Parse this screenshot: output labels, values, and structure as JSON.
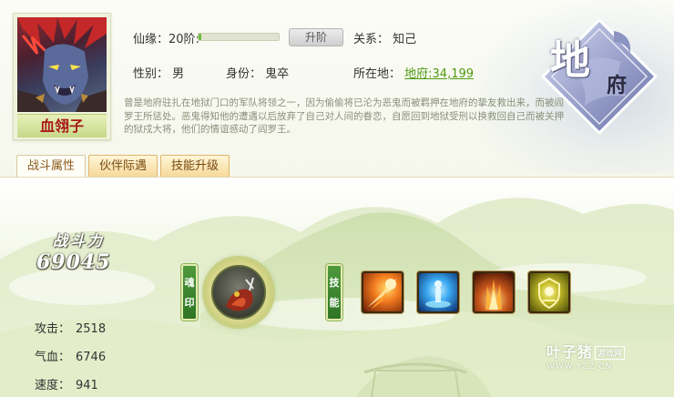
{
  "character": {
    "name": "血翎子",
    "xianyuan_label": "仙缘：20阶:",
    "xianyuan_progress": 0.03,
    "upgrade_button": "升阶",
    "relation_label": "关系：",
    "relation_value": "知己",
    "gender_label": "性别：",
    "gender_value": "男",
    "identity_label": "身份：",
    "identity_value": "鬼卒",
    "location_label": "所在地：",
    "location_value": "地府:34,199",
    "description": "曾是地府驻扎在地狱门口的军队将领之一，因为偷偷将已沦为恶鬼而被羁押在地府的挚友救出来，而被阎罗王所惩处。恶鬼得知他的遭遇以后放弃了自己对人间的眷恋，自愿回到地狱受刑以换救回自己而被关押的狱戍大将，他们的情谊感动了阎罗王。"
  },
  "emblem": {
    "char1": "地",
    "char2": "府"
  },
  "tabs": [
    {
      "label": "战斗属性",
      "active": true
    },
    {
      "label": "伙伴际遇",
      "active": false
    },
    {
      "label": "技能升级",
      "active": false
    }
  ],
  "combat": {
    "power_label": "战斗力",
    "power_value": "69045",
    "stats": [
      {
        "label": "攻击：",
        "value": "2518"
      },
      {
        "label": "气血：",
        "value": "6746"
      },
      {
        "label": "速度：",
        "value": "941"
      }
    ],
    "soul_label": "魂印",
    "skill_label": "技能",
    "skills": [
      "fire-meteor-icon",
      "water-spirit-icon",
      "flame-burst-icon",
      "golden-shield-icon"
    ]
  },
  "watermark": {
    "brand": "叶子猪",
    "tag": "游戏网",
    "url": "WWW.YZZ.CN"
  }
}
